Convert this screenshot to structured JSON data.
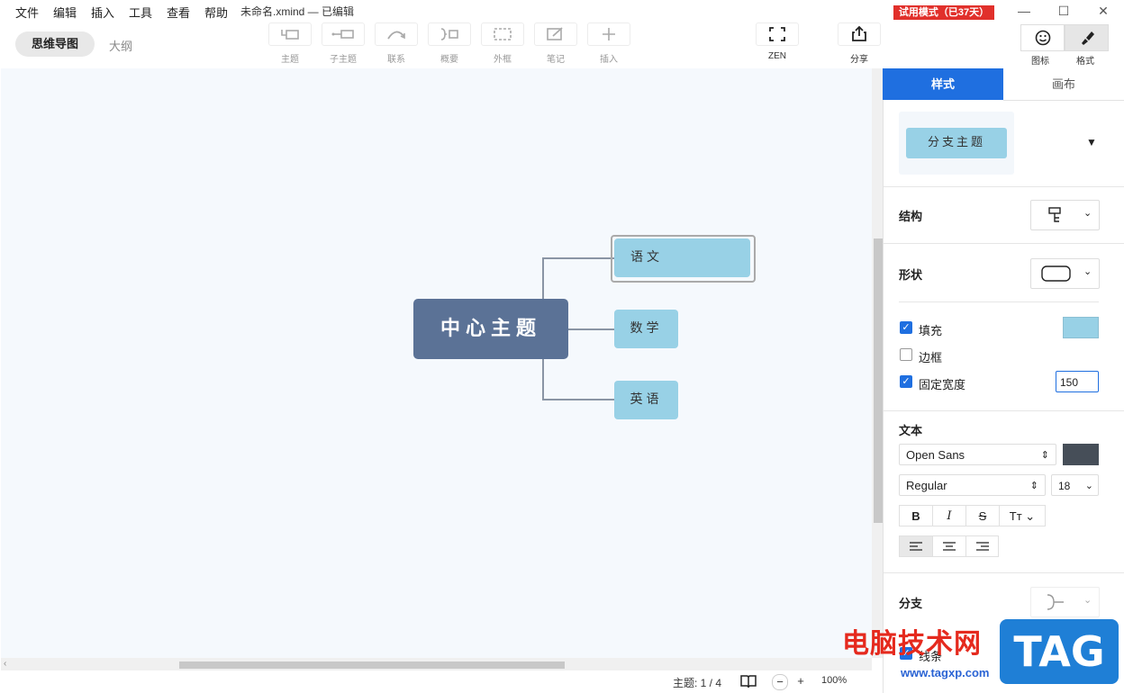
{
  "menu": [
    "文件",
    "编辑",
    "插入",
    "工具",
    "查看",
    "帮助"
  ],
  "file_title": "未命名.xmind — 已编辑",
  "trial_badge": "试用模式（已37天）",
  "view_tabs": {
    "mindmap": "思维导图",
    "outline": "大纲"
  },
  "toolbar": {
    "topic": "主题",
    "subtopic": "子主题",
    "relationship": "联系",
    "summary": "概要",
    "boundary": "外框",
    "note": "笔记",
    "insert": "插入",
    "zen": "ZEN",
    "share": "分享",
    "icons": "图标",
    "format": "格式"
  },
  "map": {
    "central": "中心主题",
    "branches": [
      "语文",
      "数学",
      "英语"
    ],
    "colors": {
      "central": "#5b7296",
      "branch": "#98d1e6",
      "line": "#8a95a5"
    }
  },
  "status": {
    "topic_count": "主题: 1 / 4",
    "zoom": "100%"
  },
  "panel": {
    "tab_style": "样式",
    "tab_canvas": "画布",
    "preview_label": "分支主题",
    "structure_label": "结构",
    "shape_label": "形状",
    "fill_label": "填充",
    "border_label": "边框",
    "fixed_width_label": "固定宽度",
    "fill_checked": true,
    "border_checked": false,
    "fixed_width_checked": true,
    "fill_color": "#98d1e6",
    "fixed_width_value": "150",
    "text_label": "文本",
    "font_family": "Open Sans",
    "font_weight": "Regular",
    "font_size": "18",
    "text_color": "#464e58",
    "branch_label": "分支",
    "line_label": "线条",
    "accent_color": "#1f6fe0"
  },
  "watermark": {
    "text": "电脑技术网",
    "url": "www.tagxp.com",
    "logo": "TAG"
  }
}
